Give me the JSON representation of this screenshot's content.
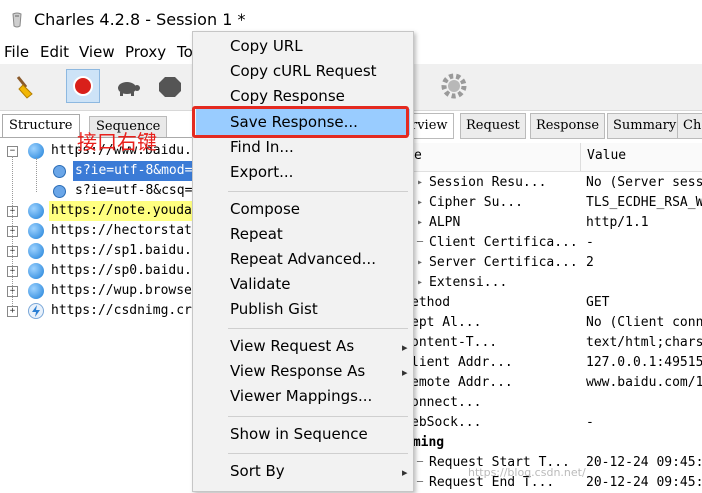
{
  "window": {
    "title": "Charles 4.2.8 - Session 1 *"
  },
  "menubar": [
    "File",
    "Edit",
    "View",
    "Proxy",
    "To"
  ],
  "left_tabs": [
    "Structure",
    "Sequence"
  ],
  "annotation": "接口右键",
  "tree": [
    {
      "text": "https://www.baidu.",
      "expand": "−",
      "icon": "globe"
    },
    {
      "text": "s?ie=utf-8&mod=",
      "child": true,
      "selected": true
    },
    {
      "text": "s?ie=utf-8&csq=",
      "child": true
    },
    {
      "text": "https://note.youda",
      "expand": "+",
      "icon": "globe",
      "yellow": true
    },
    {
      "text": "https://hectorstat",
      "expand": "+",
      "icon": "globe"
    },
    {
      "text": "https://sp1.baidu.",
      "expand": "+",
      "icon": "globe"
    },
    {
      "text": "https://sp0.baidu.",
      "expand": "+",
      "icon": "globe"
    },
    {
      "text": "https://wup.browse",
      "expand": "+",
      "icon": "globe"
    },
    {
      "text": "https://csdnimg.cr",
      "expand": "+",
      "icon": "bolt"
    }
  ],
  "right_tabs": [
    "rview",
    "Request",
    "Response",
    "Summary",
    "Cha"
  ],
  "columns": {
    "name": "e",
    "value": "Value"
  },
  "props": [
    {
      "name": "Session Resu...",
      "value": "No (Server sess",
      "tree": true
    },
    {
      "name": "Cipher Su...",
      "value": "TLS_ECDHE_RSA_W",
      "tree": true
    },
    {
      "name": "ALPN",
      "value": "http/1.1",
      "tree": true
    },
    {
      "name": "Client Certifica...",
      "value": "-",
      "tree": false
    },
    {
      "name": "Server Certifica...",
      "value": "2",
      "tree": true
    },
    {
      "name": "Extensi...",
      "value": "",
      "tree": true
    },
    {
      "name": "ethod",
      "value": "GET"
    },
    {
      "name": "ept Al...",
      "value": "No (Client conn"
    },
    {
      "name": "ontent-T...",
      "value": "text/html;chars"
    },
    {
      "name": "lient Addr...",
      "value": "127.0.0.1:49515"
    },
    {
      "name": "emote Addr...",
      "value": "www.baidu.com/1"
    },
    {
      "name": "onnect...",
      "value": ""
    },
    {
      "name": "ebSock...",
      "value": "-"
    },
    {
      "name": "iming",
      "value": "",
      "bold": true
    },
    {
      "name": "Request Start T...",
      "value": "20-12-24 09:45:",
      "tree": false
    },
    {
      "name": "Request End T...",
      "value": "20-12-24 09:45:",
      "tree": false
    }
  ],
  "context_menu": [
    {
      "label": "Copy URL"
    },
    {
      "label": "Copy cURL Request"
    },
    {
      "label": "Copy Response"
    },
    {
      "label": "Save Response...",
      "highlighted": true
    },
    {
      "label": "Find In..."
    },
    {
      "label": "Export..."
    },
    {
      "label": "Compose"
    },
    {
      "label": "Repeat"
    },
    {
      "label": "Repeat Advanced..."
    },
    {
      "label": "Validate"
    },
    {
      "label": "Publish Gist"
    },
    {
      "label": "View Request As",
      "submenu": true
    },
    {
      "label": "View Response As",
      "submenu": true
    },
    {
      "label": "Viewer Mappings..."
    },
    {
      "label": "Show in Sequence"
    },
    {
      "label": "Sort By",
      "submenu": true
    }
  ],
  "watermark": "https://blog.csdn.net/",
  "colors": {
    "selection": "#3b7bd6",
    "menu_highlight": "#99ccff",
    "annotation_red": "#e8201c",
    "record_red": "#d9201a"
  }
}
